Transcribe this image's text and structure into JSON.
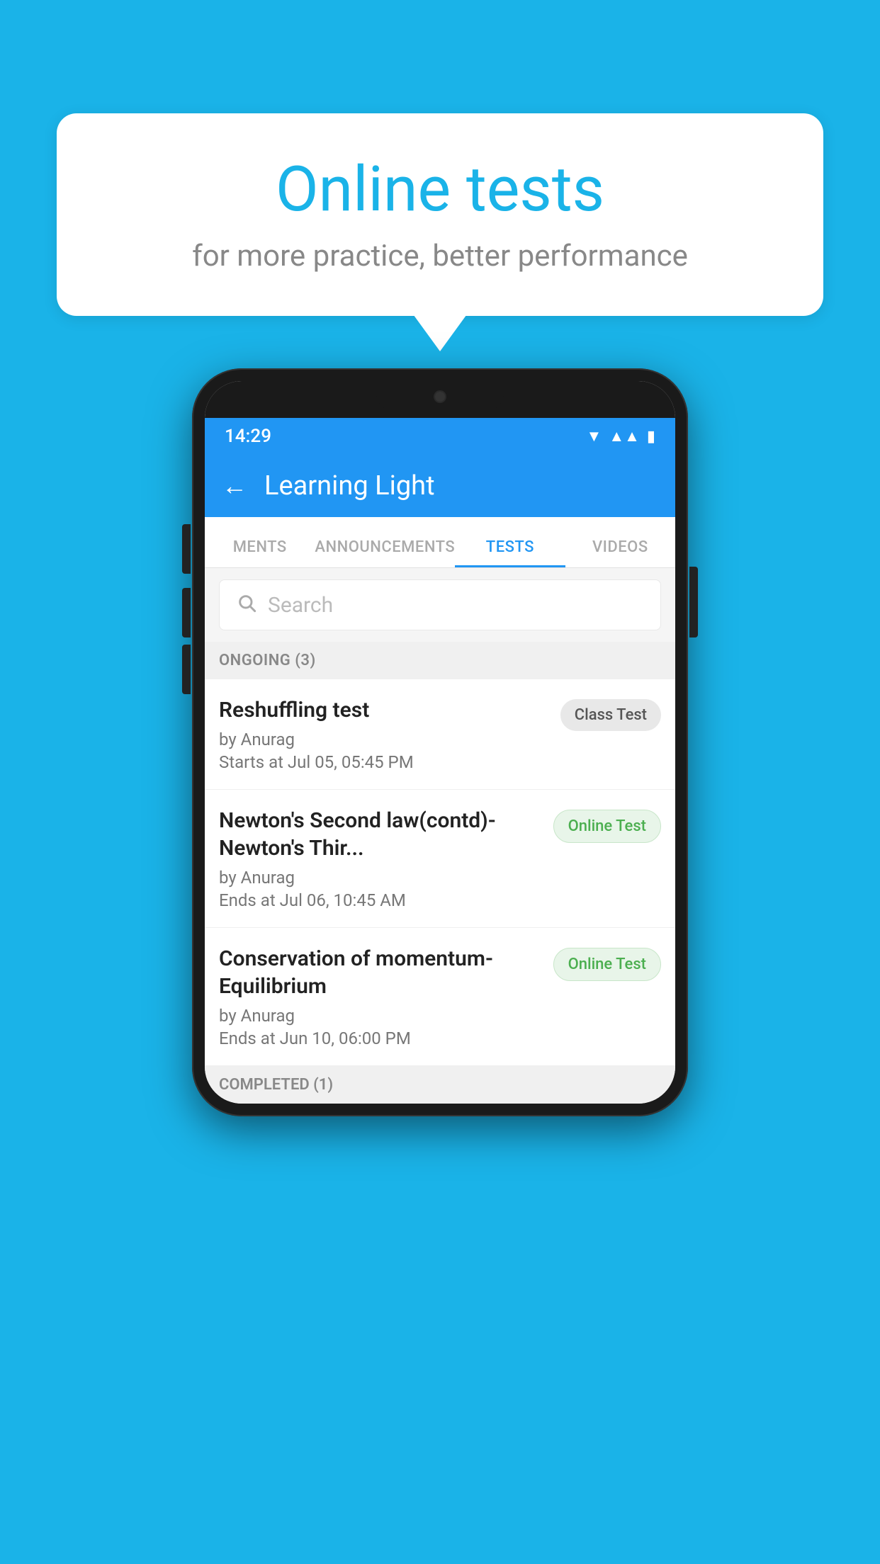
{
  "background": {
    "color": "#1ab3e8"
  },
  "speech_bubble": {
    "title": "Online tests",
    "subtitle": "for more practice, better performance"
  },
  "phone": {
    "status_bar": {
      "time": "14:29",
      "wifi": "▾",
      "signal": "▴▴",
      "battery": "▮"
    },
    "app_bar": {
      "back_label": "←",
      "title": "Learning Light"
    },
    "tabs": [
      {
        "label": "MENTS",
        "active": false
      },
      {
        "label": "ANNOUNCEMENTS",
        "active": false
      },
      {
        "label": "TESTS",
        "active": true
      },
      {
        "label": "VIDEOS",
        "active": false
      }
    ],
    "search": {
      "placeholder": "Search"
    },
    "sections": [
      {
        "header": "ONGOING (3)",
        "items": [
          {
            "name": "Reshuffling test",
            "by": "by Anurag",
            "time": "Starts at  Jul 05, 05:45 PM",
            "badge": "Class Test",
            "badge_type": "class"
          },
          {
            "name": "Newton's Second law(contd)-Newton's Thir...",
            "by": "by Anurag",
            "time": "Ends at  Jul 06, 10:45 AM",
            "badge": "Online Test",
            "badge_type": "online"
          },
          {
            "name": "Conservation of momentum-Equilibrium",
            "by": "by Anurag",
            "time": "Ends at  Jun 10, 06:00 PM",
            "badge": "Online Test",
            "badge_type": "online"
          }
        ]
      },
      {
        "header": "COMPLETED (1)",
        "items": []
      }
    ]
  }
}
